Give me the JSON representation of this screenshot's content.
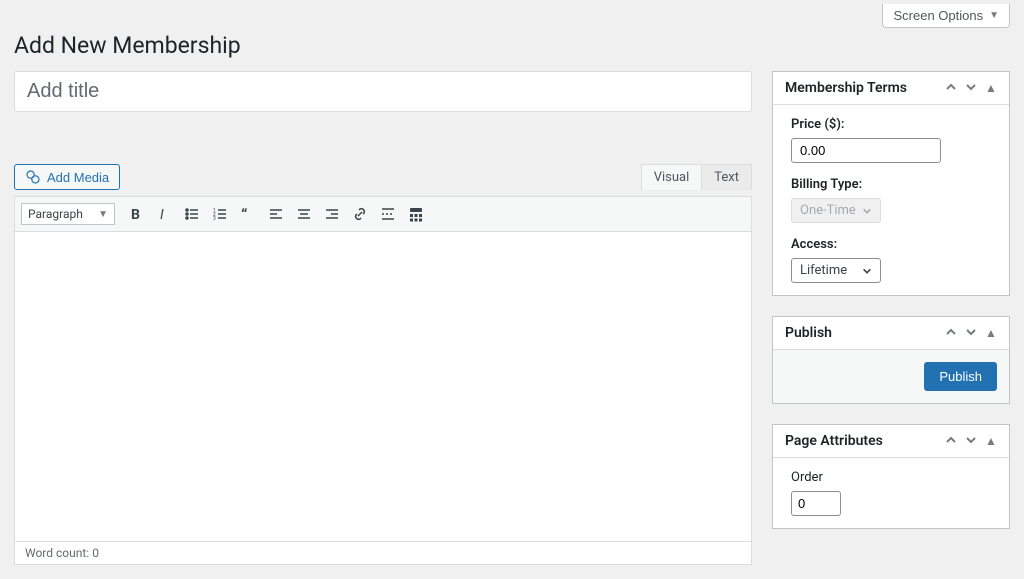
{
  "topbar": {
    "screen_options_label": "Screen Options"
  },
  "page": {
    "title": "Add New Membership",
    "title_placeholder": "Add title"
  },
  "editor": {
    "add_media_label": "Add Media",
    "tab_visual": "Visual",
    "tab_text": "Text",
    "paragraph_label": "Paragraph",
    "wordcount_label": "Word count:",
    "wordcount_value": "0"
  },
  "sidebar": {
    "membership_terms": {
      "title": "Membership Terms",
      "price_label": "Price ($):",
      "price_value": "0.00",
      "billing_type_label": "Billing Type:",
      "billing_type_value": "One-Time",
      "access_label": "Access:",
      "access_value": "Lifetime"
    },
    "publish": {
      "title": "Publish",
      "button_label": "Publish"
    },
    "page_attributes": {
      "title": "Page Attributes",
      "order_label": "Order",
      "order_value": "0"
    }
  }
}
